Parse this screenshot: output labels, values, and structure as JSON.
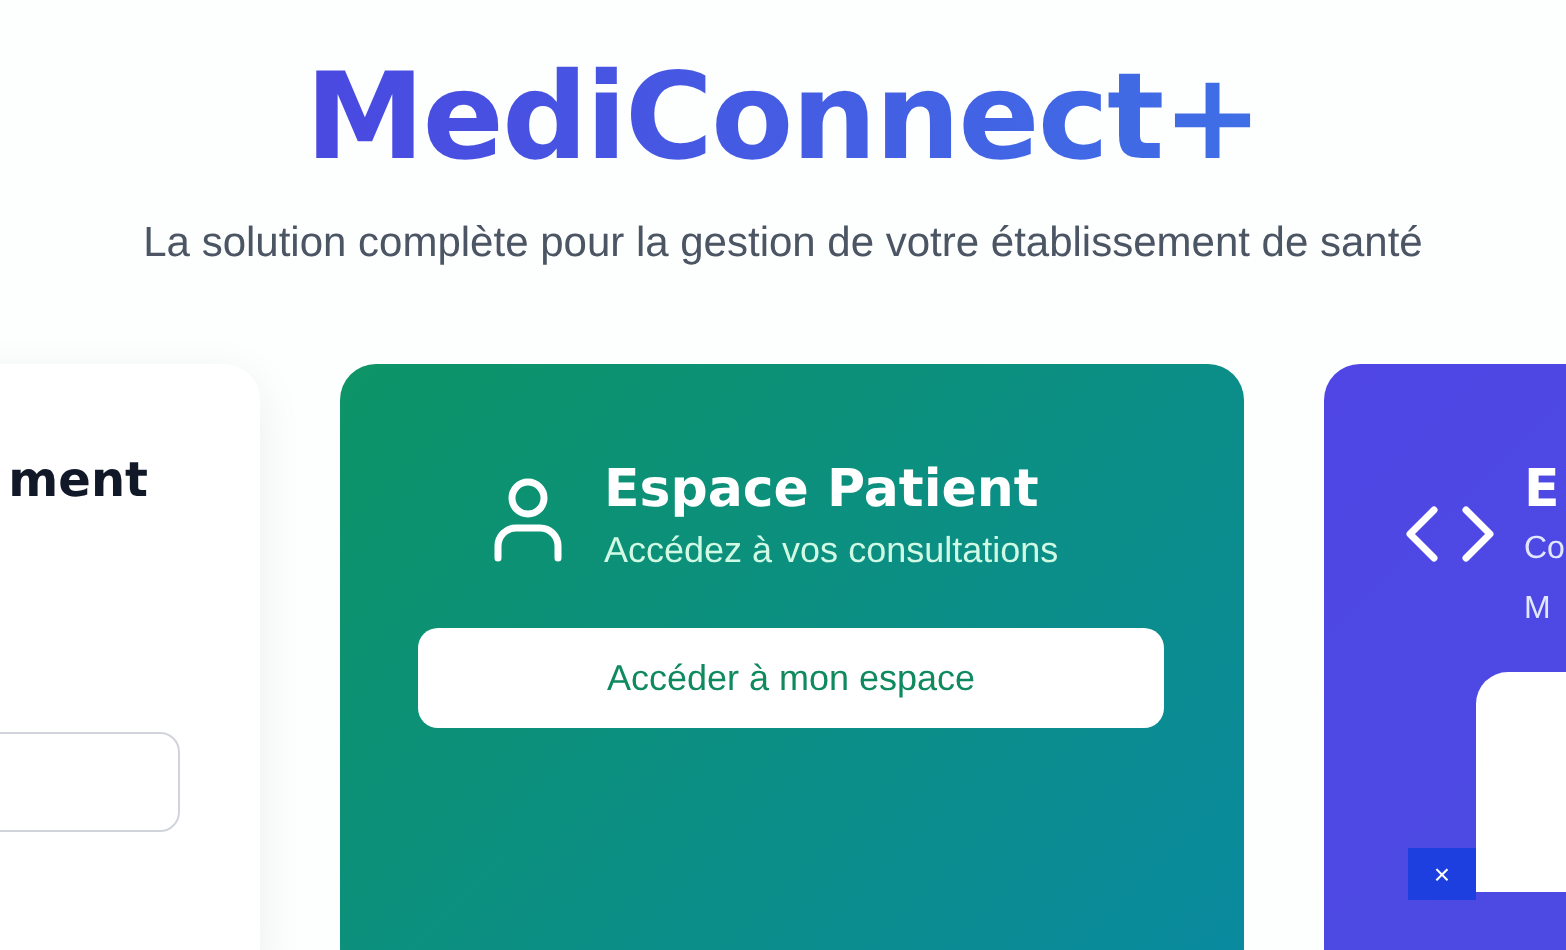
{
  "header": {
    "title": "MediConnect+",
    "subtitle": "La solution complète pour la gestion de votre établissement de santé"
  },
  "cards": [
    {
      "kind": "form",
      "title": "ment"
    },
    {
      "kind": "patient",
      "title": "Espace Patient",
      "subtitle": "Accédez à vos consultations",
      "button": "Accéder à mon espace"
    },
    {
      "kind": "developer",
      "title": "E",
      "subtitle_lines": [
        "Co",
        "M"
      ],
      "close": "×"
    }
  ]
}
